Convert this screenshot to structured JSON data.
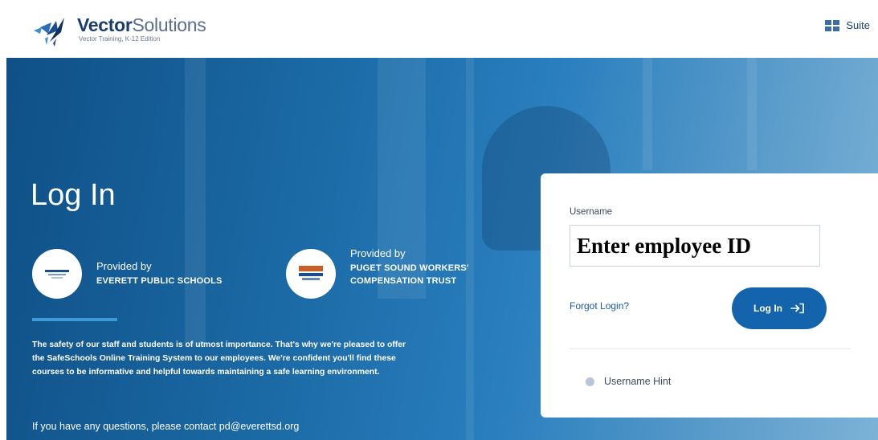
{
  "header": {
    "brand_bold": "Vector",
    "brand_light": "Solutions",
    "brand_sub": "Vector Training, K-12 Edition",
    "suite_label": "Suite"
  },
  "hero": {
    "title": "Log In",
    "providers": [
      {
        "by": "Provided by",
        "name_line1": "EVERETT PUBLIC SCHOOLS",
        "name_line2": ""
      },
      {
        "by": "Provided by",
        "name_line1": "PUGET SOUND WORKERS'",
        "name_line2": "COMPENSATION TRUST"
      }
    ],
    "description": "The safety of our staff and students is of utmost importance. That's why we're pleased to offer the SafeSchools Online Training System to our employees. We're confident you'll find these courses to be informative and helpful towards maintaining a safe learning environment.",
    "contact": "If you have any questions, please contact pd@everettsd.org"
  },
  "login": {
    "username_label": "Username",
    "username_value": "Enter employee ID",
    "forgot_label": "Forgot Login?",
    "login_button_label": "Log In",
    "hint_label": "Username Hint"
  },
  "colors": {
    "brand_navy": "#1b3d6e",
    "button_blue": "#1364ad",
    "accent_bar": "#3d9ad9"
  },
  "icons": {
    "brand": "vector-logo-icon",
    "suite": "grid-icon",
    "login": "sign-in-arrow-icon",
    "hint": "circle-icon"
  }
}
